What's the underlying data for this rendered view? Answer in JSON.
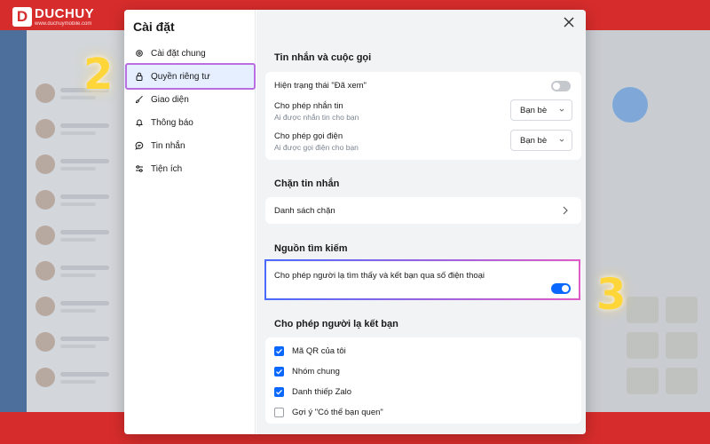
{
  "brand": {
    "mark": "D",
    "name": "DUCHUY",
    "sub": "www.duchuymobile.com"
  },
  "settings": {
    "title": "Cài đặt",
    "nav": [
      {
        "label": "Cài đặt chung",
        "icon": "gear-icon"
      },
      {
        "label": "Quyền riêng tư",
        "icon": "lock-icon",
        "active": true
      },
      {
        "label": "Giao diện",
        "icon": "brush-icon"
      },
      {
        "label": "Thông báo",
        "icon": "bell-icon"
      },
      {
        "label": "Tin nhắn",
        "icon": "chat-icon"
      },
      {
        "label": "Tiện ích",
        "icon": "sliders-icon"
      }
    ]
  },
  "sections": {
    "messages_calls": {
      "title": "Tin nhắn và cuộc gọi",
      "seen_status": {
        "label": "Hiện trạng thái \"Đã xem\"",
        "enabled": false
      },
      "allow_messages": {
        "label": "Cho phép nhắn tin",
        "sub": "Ai được nhắn tin cho bạn",
        "value": "Bạn bè"
      },
      "allow_calls": {
        "label": "Cho phép gọi điện",
        "sub": "Ai được gọi điện cho bạn",
        "value": "Bạn bè"
      }
    },
    "block": {
      "title": "Chặn tin nhắn",
      "list_label": "Danh sách chặn"
    },
    "search_source": {
      "title": "Nguồn tìm kiếm",
      "phone_search": {
        "label": "Cho phép người lạ tìm thấy và kết bạn qua số điện thoại",
        "enabled": true
      }
    },
    "friend_requests": {
      "title": "Cho phép người lạ kết bạn",
      "options": [
        {
          "label": "Mã QR của tôi",
          "checked": true
        },
        {
          "label": "Nhóm chung",
          "checked": true
        },
        {
          "label": "Danh thiếp Zalo",
          "checked": true
        },
        {
          "label": "Gợi ý \"Có thể bạn quen\"",
          "checked": false
        }
      ]
    }
  },
  "steps": {
    "step2": "2",
    "step3": "3"
  },
  "colors": {
    "accent": "#0a68ff",
    "brand_red": "#d72c2c",
    "highlight": "#c06ad8",
    "step_yellow": "#ffd63a"
  }
}
